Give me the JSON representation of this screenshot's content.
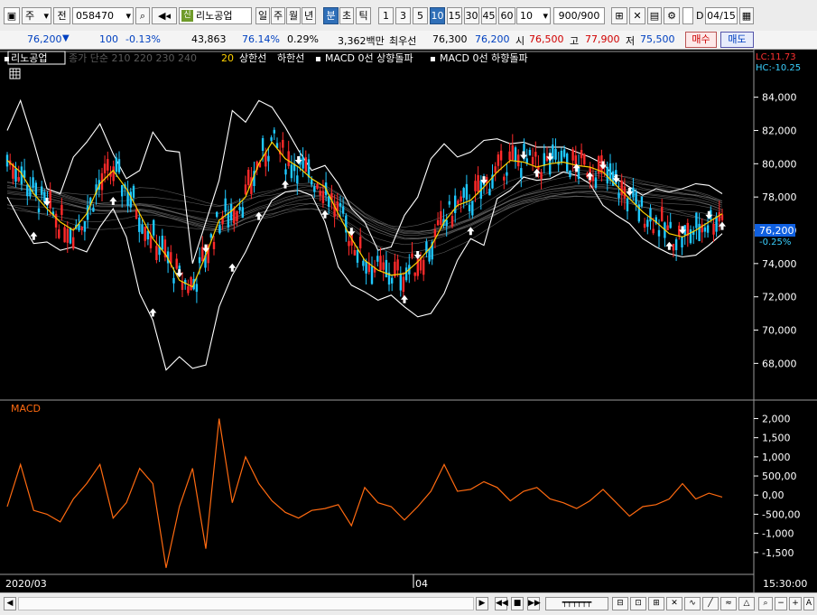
{
  "toolbar": {
    "market": "주",
    "prev": "전",
    "code": "058470",
    "name_badge": "신",
    "name": "리노공업",
    "periods": [
      "일",
      "주",
      "월",
      "년",
      "분",
      "초",
      "틱"
    ],
    "active_period": "분",
    "intervals": [
      "1",
      "3",
      "5",
      "10",
      "15",
      "30",
      "45",
      "60"
    ],
    "active_interval": "10",
    "interval_select": "10",
    "count": "900/900",
    "date_value": "04/15",
    "date_prefix": "D"
  },
  "quote": {
    "price": "76,200",
    "change": "100",
    "change_pct": "-0.13%",
    "volume": "43,863",
    "vol_ratio": "76.14%",
    "turnover": "0.29%",
    "amount": "3,362백만",
    "best_label": "최우선",
    "best_ask": "76,300",
    "best_bid": "76,200",
    "open_label": "시",
    "open": "76,500",
    "high_label": "고",
    "high": "77,900",
    "low_label": "저",
    "low": "75,500",
    "buy": "매수",
    "sell": "매도"
  },
  "legend": {
    "stock": "리노공업",
    "ma_text": "종가 단순 210 220 230 240",
    "ma_last": "20",
    "upper": "상한선",
    "lower": "하한선",
    "sig_up": "MACD 0선 상향돌파",
    "sig_down": "MACD 0선 하향돌파",
    "lc": "LC:11.73",
    "hc": "HC:-10.25"
  },
  "macd_label": "MACD",
  "price_tag": "76,200",
  "pct_tag": "-0.25%",
  "x_labels": [
    "2020/03",
    "04"
  ],
  "time_label": "15:30:00",
  "colors": {
    "up": "#ff2a2a",
    "down": "#1ec8ff",
    "band": "#ffffff",
    "ma20": "#ffd200",
    "macd": "#ff6a10",
    "ribbon": "#7a7a7a"
  },
  "chart_data": [
    {
      "type": "candlestick",
      "title": "리노공업",
      "ylim": [
        66500,
        85500
      ],
      "y_ticks": [
        68000,
        70000,
        72000,
        74000,
        76000,
        78000,
        80000,
        82000,
        84000
      ],
      "y_tick_labels": [
        "68,000",
        "70,000",
        "72,000",
        "74,000",
        "76,000",
        "78,000",
        "80,000",
        "82,000",
        "84,000"
      ],
      "x_labels": [
        "2020/03",
        "04"
      ],
      "series": [
        {
          "name": "20",
          "values": [
            80200,
            79500,
            78200,
            77300,
            76500,
            76000,
            77000,
            78800,
            79600,
            78500,
            77000,
            75500,
            74500,
            73000,
            72600,
            74500,
            76600,
            77200,
            78000,
            80000,
            81300,
            80300,
            79800,
            79100,
            78600,
            77000,
            75500,
            74200,
            73600,
            73300,
            73400,
            74100,
            75000,
            76500,
            77500,
            77800,
            78600,
            79500,
            80200,
            80100,
            79800,
            80000,
            80100,
            79900,
            79800,
            79500,
            78700,
            77900,
            77100,
            76500,
            75800,
            75600,
            76000,
            76500,
            77000
          ]
        }
      ],
      "band_upper": [
        82000,
        83800,
        81300,
        78500,
        78200,
        80400,
        81300,
        82400,
        80600,
        79100,
        79600,
        81900,
        80800,
        80700,
        74000,
        76500,
        79000,
        83200,
        82500,
        83800,
        83400,
        82200,
        80800,
        79600,
        79900,
        78800,
        77300,
        76500,
        74800,
        75000,
        76900,
        78000,
        80300,
        81200,
        80400,
        80700,
        81400,
        81500,
        81200,
        81300,
        81000,
        81000,
        81000,
        80700,
        80400,
        80000,
        79100,
        78600,
        78100,
        78500,
        78300,
        78500,
        78800,
        78700,
        78200
      ],
      "band_lower": [
        78000,
        76500,
        75200,
        75300,
        74800,
        75000,
        74700,
        76200,
        77300,
        75600,
        72200,
        70600,
        67600,
        68400,
        67700,
        67900,
        71400,
        73300,
        74700,
        76400,
        77800,
        78300,
        78400,
        78100,
        76500,
        73800,
        72700,
        72300,
        71800,
        72100,
        71400,
        70800,
        71000,
        72200,
        74200,
        75500,
        75100,
        77900,
        78400,
        79200,
        79000,
        79100,
        79500,
        79300,
        78800,
        77500,
        76900,
        76400,
        75500,
        75000,
        74600,
        74400,
        74500,
        75100,
        75800
      ],
      "ma_ribbon_mid": [
        78300,
        78200,
        78100,
        78000,
        77800,
        77600,
        77400,
        77300,
        77300,
        77300,
        77400,
        77300,
        77100,
        76900,
        76700,
        76500,
        76400,
        76600,
        77000,
        77300,
        77500,
        77800,
        78000,
        78100,
        78000,
        77600,
        77100,
        76500,
        76100,
        75800,
        75600,
        75600,
        75700,
        75900,
        76200,
        76500,
        76900,
        77300,
        77700,
        78000,
        78200,
        78400,
        78500,
        78600,
        78600,
        78600,
        78500,
        78400,
        78200,
        78100,
        78000,
        77900,
        77800,
        77600,
        77300
      ],
      "signals_up_x": [
        2,
        8,
        11,
        17,
        19,
        21,
        24,
        30,
        35,
        40,
        43,
        44,
        50,
        54
      ],
      "signals_down_x": [
        3,
        13,
        15,
        22,
        26,
        31,
        36,
        39,
        41,
        45,
        46,
        47,
        51,
        53
      ]
    },
    {
      "type": "line",
      "title": "MACD",
      "ylim": [
        -2000,
        2200
      ],
      "y_ticks": [
        -1500,
        -1000,
        -500,
        0,
        500,
        1000,
        1500,
        2000
      ],
      "y_tick_labels": [
        "-1,500",
        "-1,000",
        "-500,00",
        "0,00",
        "500,00",
        "1,000",
        "1,500",
        "2,000"
      ],
      "series": [
        {
          "name": "MACD",
          "values": [
            -300,
            800,
            -400,
            -500,
            -700,
            -100,
            300,
            800,
            -600,
            -200,
            700,
            300,
            -1900,
            -300,
            700,
            -1400,
            2000,
            -200,
            1000,
            300,
            -150,
            -450,
            -600,
            -400,
            -350,
            -250,
            -800,
            200,
            -200,
            -300,
            -650,
            -300,
            100,
            800,
            100,
            150,
            350,
            200,
            -150,
            100,
            200,
            -100,
            -200,
            -350,
            -150,
            150,
            -200,
            -550,
            -300,
            -250,
            -100,
            300,
            -100,
            50,
            -50
          ]
        }
      ]
    }
  ]
}
